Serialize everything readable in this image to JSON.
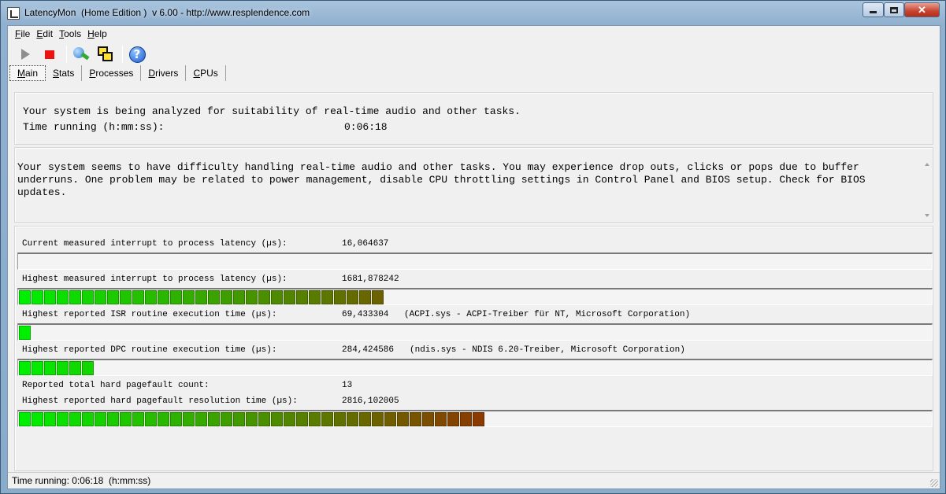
{
  "window": {
    "title": "LatencyMon  (Home Edition )  v 6.00 - http://www.resplendence.com"
  },
  "menu": [
    {
      "underline": "F",
      "rest": "ile"
    },
    {
      "underline": "E",
      "rest": "dit"
    },
    {
      "underline": "T",
      "rest": "ools"
    },
    {
      "underline": "H",
      "rest": "elp"
    }
  ],
  "toolbar": {
    "icons": [
      "play-icon",
      "stop-icon",
      "analyze-icon",
      "windows-icon",
      "help-icon"
    ]
  },
  "tabs": [
    {
      "underline": "M",
      "rest": "ain",
      "active": true
    },
    {
      "underline": "S",
      "rest": "tats",
      "active": false
    },
    {
      "underline": "P",
      "rest": "rocesses",
      "active": false
    },
    {
      "underline": "D",
      "rest": "rivers",
      "active": false
    },
    {
      "underline": "C",
      "rest": "PUs",
      "active": false
    }
  ],
  "status_panel": {
    "line1": "Your system is being analyzed for suitability of real-time audio and other tasks.",
    "time_label": "Time running (h:mm:ss):",
    "time_value": "0:06:18"
  },
  "conclusion": {
    "text": "Your system seems to have difficulty handling real-time audio and other tasks. You may experience drop outs, clicks or pops due to buffer underruns. One problem may be related to power management, disable CPU throttling settings in Control Panel and BIOS setup. Check for BIOS updates."
  },
  "metrics": [
    {
      "label": "Current measured interrupt to process latency (µs):",
      "value": "16,064637",
      "source": "",
      "bar_segments": 0
    },
    {
      "label": "Highest measured interrupt to process latency (µs):",
      "value": "1681,878242",
      "source": "",
      "bar_segments": 29
    },
    {
      "label": "Highest reported ISR routine execution time (µs):",
      "value": "69,433304",
      "source": "(ACPI.sys - ACPI-Treiber für NT, Microsoft Corporation)",
      "bar_segments": 1
    },
    {
      "label": "Highest reported DPC routine execution time (µs):",
      "value": "284,424586",
      "source": "(ndis.sys - NDIS 6.20-Treiber, Microsoft Corporation)",
      "bar_segments": 6
    },
    {
      "label": "Reported total hard pagefault count:",
      "value": "13",
      "source": "",
      "bar_segments": null
    },
    {
      "label": "Highest reported hard pagefault resolution time (µs):",
      "value": "2816,102005",
      "source": "",
      "bar_segments": 37
    }
  ],
  "colors": {
    "bar_low": "#00ee00",
    "bar_high": "#8b3a00"
  },
  "statusbar": {
    "text": "Time running: 0:06:18  (h:mm:ss)"
  }
}
